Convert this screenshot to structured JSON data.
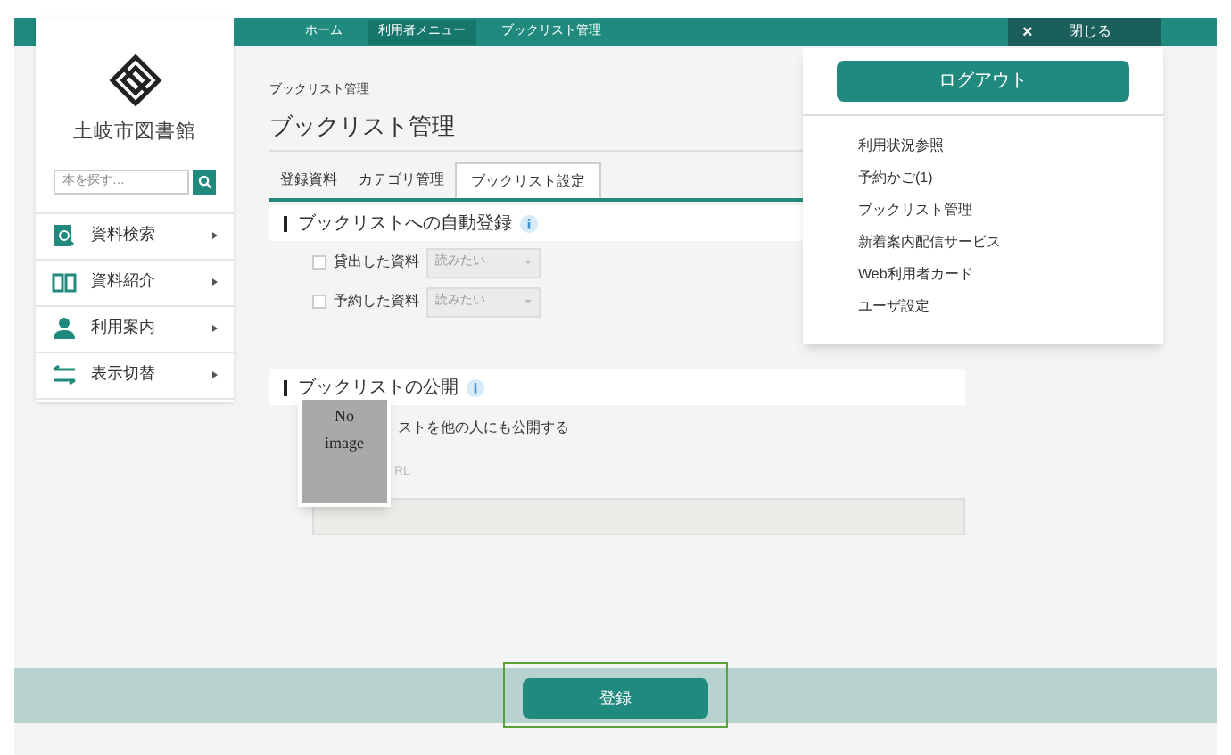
{
  "library": {
    "name": "土岐市図書館"
  },
  "search": {
    "placeholder": "本を探す…"
  },
  "sidebar": {
    "items": [
      {
        "label": "資料検索"
      },
      {
        "label": "資料紹介"
      },
      {
        "label": "利用案内"
      },
      {
        "label": "表示切替"
      }
    ]
  },
  "breadcrumb": [
    "ホーム",
    "利用者メニュー",
    "ブックリスト管理"
  ],
  "close_button": {
    "icon": "×",
    "label": "閉じる"
  },
  "page": {
    "small_title": "ブックリスト管理",
    "title": "ブックリスト管理"
  },
  "tabs": [
    {
      "label": "登録資料",
      "selected": false
    },
    {
      "label": "カテゴリ管理",
      "selected": false
    },
    {
      "label": "ブックリスト設定",
      "selected": true
    }
  ],
  "auto_register": {
    "heading": "ブックリストへの自動登録",
    "rows": [
      {
        "label": "貸出した資料",
        "checked": false,
        "value": "読みたい"
      },
      {
        "label": "予約した資料",
        "checked": false,
        "value": "読みたい"
      }
    ]
  },
  "publish": {
    "heading": "ブックリストの公開",
    "option_label": "ストを他の人にも公開する",
    "url_label": "RL"
  },
  "no_image": {
    "line_1": "No",
    "line_2": "image"
  },
  "user_menu": {
    "logout": "ログアウト",
    "items": [
      "利用状況参照",
      "予約かご(1)",
      "ブックリスト管理",
      "新着案内配信サービス",
      "Web利用者カード",
      "ユーザ設定"
    ]
  },
  "submit_button": "登録"
}
